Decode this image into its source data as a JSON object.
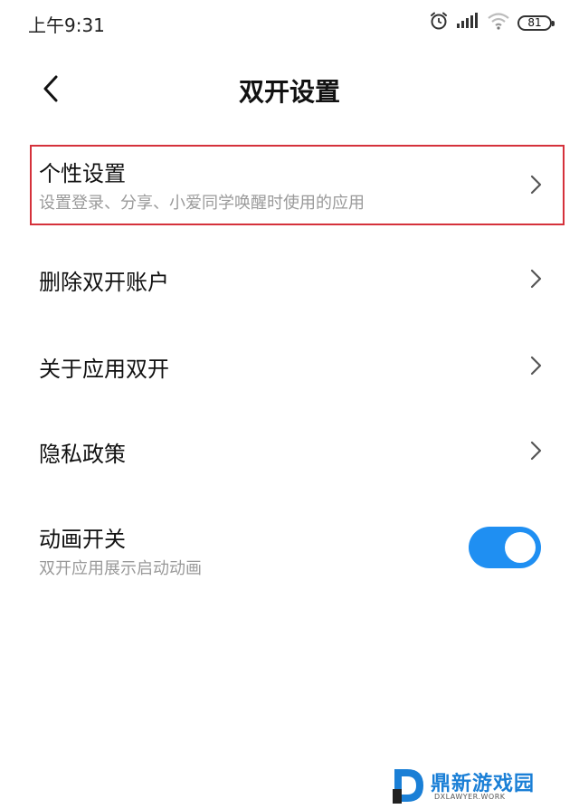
{
  "status_bar": {
    "time": "上午9:31",
    "battery": "81",
    "icons": [
      "alarm-icon",
      "signal-icon",
      "wifi-icon",
      "battery-icon"
    ]
  },
  "header": {
    "title": "双开设置",
    "back_icon": "chevron-left-icon"
  },
  "items": [
    {
      "title": "个性设置",
      "subtitle": "设置登录、分享、小爱同学唤醒时使用的应用",
      "highlighted": true
    },
    {
      "title": "删除双开账户"
    },
    {
      "title": "关于应用双开"
    },
    {
      "title": "隐私政策"
    },
    {
      "title": "动画开关",
      "subtitle": "双开应用展示启动动画",
      "toggle_on": true
    }
  ],
  "watermark": {
    "text": "鼎新游戏园",
    "sub": "DXLAWYER.WORK"
  },
  "colors": {
    "accent": "#1f8ff2",
    "highlight_border": "#d5313b",
    "subtitle": "#9a9a9a",
    "watermark": "#1a7fd6"
  }
}
